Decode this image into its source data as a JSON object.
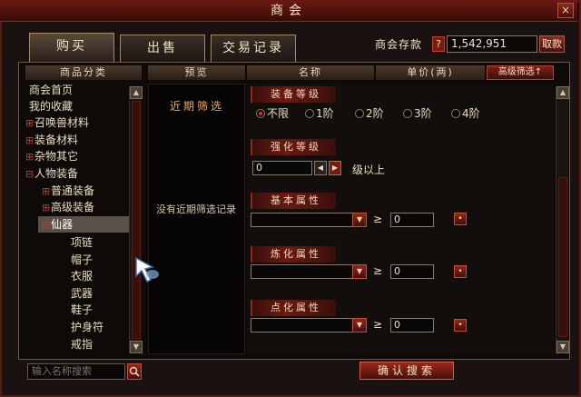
{
  "window": {
    "title": "商会"
  },
  "tabs": [
    {
      "label": "购买",
      "active": true
    },
    {
      "label": "出售",
      "active": false
    },
    {
      "label": "交易记录",
      "active": false
    }
  ],
  "bank": {
    "label": "商会存款",
    "help": "?",
    "amount": "1,542,951",
    "withdraw_label": "取款"
  },
  "headers": {
    "category": "商品分类",
    "preview": "预览",
    "name": "名称",
    "price": "单价(两)",
    "advanced_filter": "高级筛选↑"
  },
  "sidebar": {
    "items": [
      {
        "label": "商会首页",
        "prefix": ""
      },
      {
        "label": "我的收藏",
        "prefix": ""
      },
      {
        "label": "召唤兽材料",
        "prefix": "⊞"
      },
      {
        "label": "装备材料",
        "prefix": "⊞"
      },
      {
        "label": "杂物其它",
        "prefix": "⊞"
      },
      {
        "label": "人物装备",
        "prefix": "⊟"
      },
      {
        "label": "普通装备",
        "prefix": "⊞"
      },
      {
        "label": "高级装备",
        "prefix": "⊞"
      },
      {
        "label": "仙器",
        "prefix": "⊟",
        "selected": true
      },
      {
        "label": "项链",
        "prefix": ""
      },
      {
        "label": "帽子",
        "prefix": ""
      },
      {
        "label": "衣服",
        "prefix": ""
      },
      {
        "label": "武器",
        "prefix": ""
      },
      {
        "label": "鞋子",
        "prefix": ""
      },
      {
        "label": "护身符",
        "prefix": ""
      },
      {
        "label": "戒指",
        "prefix": ""
      }
    ]
  },
  "search": {
    "placeholder": "输入名称搜索"
  },
  "recent": {
    "title": "近期筛选",
    "empty_text": "没有近期筛选记录"
  },
  "filters": {
    "equip_level": {
      "label": "装备等级",
      "options": [
        "不限",
        "1阶",
        "2阶",
        "3阶",
        "4阶"
      ],
      "selected": "不限"
    },
    "enhance_level": {
      "label": "强化等级",
      "value": "0",
      "suffix": "级以上"
    },
    "basic_attr": {
      "label": "基本属性",
      "ge": "≥",
      "value": "0"
    },
    "refine_attr": {
      "label": "炼化属性",
      "ge": "≥",
      "value": "0"
    },
    "dot_attr": {
      "label": "点化属性",
      "ge": "≥",
      "value": "0"
    }
  },
  "confirm_label": "确认搜索",
  "colors": {
    "accent": "#8a2a1a",
    "frame": "#5a1a10",
    "text": "#e8dcc0"
  }
}
